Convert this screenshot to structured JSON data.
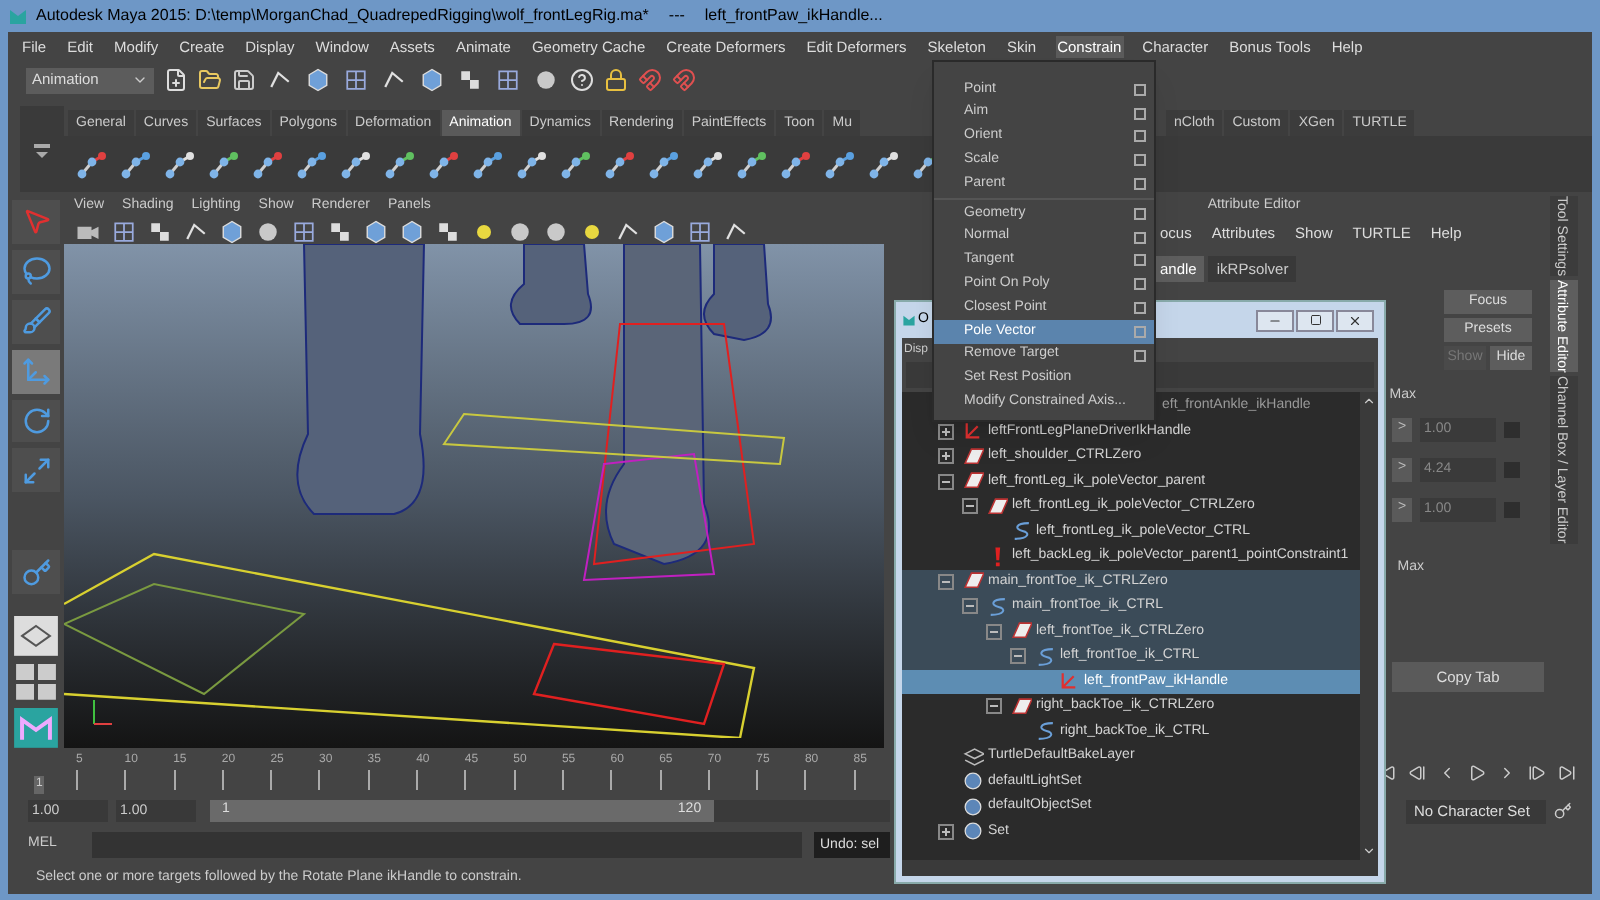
{
  "window": {
    "title": "Autodesk Maya 2015: D:\\temp\\MorganChad_QuadrepedRigging\\wolf_frontLegRig.ma*",
    "separator": "---",
    "selection": "left_frontPaw_ikHandle..."
  },
  "menu_bar": [
    {
      "label": "File",
      "selected": false
    },
    {
      "label": "Edit",
      "selected": false
    },
    {
      "label": "Modify",
      "selected": false
    },
    {
      "label": "Create",
      "selected": false
    },
    {
      "label": "Display",
      "selected": false
    },
    {
      "label": "Window",
      "selected": false
    },
    {
      "label": "Assets",
      "selected": false
    },
    {
      "label": "Animate",
      "selected": false
    },
    {
      "label": "Geometry Cache",
      "selected": false
    },
    {
      "label": "Create Deformers",
      "selected": false
    },
    {
      "label": "Edit Deformers",
      "selected": false
    },
    {
      "label": "Skeleton",
      "selected": false
    },
    {
      "label": "Skin",
      "selected": false
    },
    {
      "label": "Constrain",
      "selected": true
    },
    {
      "label": "Character",
      "selected": false
    },
    {
      "label": "Bonus Tools",
      "selected": false
    },
    {
      "label": "Help",
      "selected": false
    }
  ],
  "menu_set": "Animation",
  "shelf_tabs": [
    {
      "label": "General",
      "selected": false
    },
    {
      "label": "Curves",
      "selected": false
    },
    {
      "label": "Surfaces",
      "selected": false
    },
    {
      "label": "Polygons",
      "selected": false
    },
    {
      "label": "Deformation",
      "selected": false
    },
    {
      "label": "Animation",
      "selected": true
    },
    {
      "label": "Dynamics",
      "selected": false
    },
    {
      "label": "Rendering",
      "selected": false
    },
    {
      "label": "PaintEffects",
      "selected": false
    },
    {
      "label": "Toon",
      "selected": false
    },
    {
      "label": "Mu",
      "selected": false
    },
    {
      "label": "nCloth",
      "selected": false
    },
    {
      "label": "Custom",
      "selected": false
    },
    {
      "label": "XGen",
      "selected": false
    },
    {
      "label": "TURTLE",
      "selected": false
    }
  ],
  "toolbox": [
    {
      "kind": "select",
      "selected": false
    },
    {
      "kind": "lasso",
      "selected": false
    },
    {
      "kind": "paint",
      "selected": false
    },
    {
      "kind": "move",
      "selected": true
    },
    {
      "kind": "rotate",
      "selected": false
    },
    {
      "kind": "scale",
      "selected": false
    },
    {
      "kind": "ik",
      "selected": false
    }
  ],
  "viewport": {
    "menu": [
      "View",
      "Shading",
      "Lighting",
      "Show",
      "Renderer",
      "Panels"
    ]
  },
  "constrain_menu": {
    "sections": [
      [
        {
          "label": "Point",
          "option_box": true,
          "selected": false
        },
        {
          "label": "Aim",
          "option_box": true,
          "selected": false
        },
        {
          "label": "Orient",
          "option_box": true,
          "selected": false
        },
        {
          "label": "Scale",
          "option_box": true,
          "selected": false
        },
        {
          "label": "Parent",
          "option_box": true,
          "selected": false
        }
      ],
      [
        {
          "label": "Geometry",
          "option_box": true,
          "selected": false
        },
        {
          "label": "Normal",
          "option_box": true,
          "selected": false
        },
        {
          "label": "Tangent",
          "option_box": true,
          "selected": false
        },
        {
          "label": "Point On Poly",
          "option_box": true,
          "selected": false
        },
        {
          "label": "Closest Point",
          "option_box": true,
          "selected": false
        },
        {
          "label": "Pole Vector",
          "option_box": true,
          "selected": true
        },
        {
          "label": "Remove Target",
          "option_box": true,
          "selected": false
        },
        {
          "label": "Set Rest Position",
          "option_box": false,
          "selected": false
        },
        {
          "label": "Modify Constrained Axis...",
          "option_box": false,
          "selected": false
        }
      ]
    ]
  },
  "attribute_editor": {
    "title": "Attribute Editor",
    "menu": [
      "ocus",
      "Attributes",
      "Show",
      "TURTLE",
      "Help"
    ],
    "tabs": [
      {
        "label": "andle",
        "selected": true
      },
      {
        "label": "ikRPsolver",
        "selected": false
      }
    ],
    "buttons": [
      {
        "label": "Focus",
        "disabled": false
      },
      {
        "label": "Presets",
        "disabled": false
      },
      {
        "label": "Show",
        "disabled": true
      },
      {
        "label": "Hide",
        "disabled": false
      }
    ],
    "max_header": "Max",
    "fields": [
      {
        "button": ">",
        "value": "1.00"
      },
      {
        "button": ">",
        "value": "4.24"
      },
      {
        "button": ">",
        "value": "1.00"
      }
    ],
    "max_header_2": "Max",
    "copy_tab": "Copy Tab"
  },
  "side_tabs": [
    {
      "label": "Tool Settings",
      "selected": false
    },
    {
      "label": "Attribute Editor",
      "selected": true
    },
    {
      "label": "Channel Box / Layer Editor",
      "selected": false
    }
  ],
  "outliner": {
    "title": "O",
    "menu": [
      "Disp"
    ],
    "partial_row": "eft_frontAnkle_ikHandle",
    "nodes": [
      {
        "label": "leftFrontLegPlaneDriverIkHandle",
        "kind": "ikhandle",
        "expanded": false,
        "selected": false,
        "highlighted": false
      },
      {
        "label": "left_shoulder_CTRLZero",
        "kind": "transform",
        "expanded": false,
        "selected": false,
        "highlighted": false
      },
      {
        "label": "left_frontLeg_ik_poleVector_parent",
        "kind": "transform",
        "expanded": true,
        "selected": false,
        "highlighted": false,
        "children": [
          {
            "label": "left_frontLeg_ik_poleVector_CTRLZero",
            "kind": "transform",
            "expanded": true,
            "selected": false,
            "highlighted": false,
            "children": [
              {
                "label": "left_frontLeg_ik_poleVector_CTRL",
                "kind": "curve",
                "selected": false,
                "highlighted": false
              }
            ]
          },
          {
            "label": "left_backLeg_ik_poleVector_parent1_pointConstraint1",
            "kind": "constraint",
            "selected": false,
            "highlighted": false
          }
        ]
      },
      {
        "label": "main_frontToe_ik_CTRLZero",
        "kind": "transform",
        "expanded": true,
        "selected": false,
        "highlighted": true,
        "children": [
          {
            "label": "main_frontToe_ik_CTRL",
            "kind": "curve",
            "expanded": true,
            "selected": false,
            "highlighted": true,
            "children": [
              {
                "label": "left_frontToe_ik_CTRLZero",
                "kind": "transform",
                "expanded": true,
                "selected": false,
                "highlighted": true,
                "children": [
                  {
                    "label": "left_frontToe_ik_CTRL",
                    "kind": "curve",
                    "expanded": true,
                    "selected": false,
                    "highlighted": true,
                    "children": [
                      {
                        "label": "left_frontPaw_ikHandle",
                        "kind": "ikhandle",
                        "selected": true,
                        "highlighted": true
                      }
                    ]
                  }
                ]
              },
              {
                "label": "right_backToe_ik_CTRLZero",
                "kind": "transform",
                "expanded": true,
                "selected": false,
                "highlighted": false,
                "children": [
                  {
                    "label": "right_backToe_ik_CTRL",
                    "kind": "curve",
                    "selected": false,
                    "highlighted": false
                  }
                ]
              }
            ]
          }
        ]
      },
      {
        "label": "TurtleDefaultBakeLayer",
        "kind": "layer",
        "selected": false,
        "highlighted": false
      },
      {
        "label": "defaultLightSet",
        "kind": "set",
        "selected": false,
        "highlighted": false
      },
      {
        "label": "defaultObjectSet",
        "kind": "set",
        "selected": false,
        "highlighted": false
      },
      {
        "label": "Set",
        "kind": "set",
        "expanded": false,
        "selected": false,
        "highlighted": false
      }
    ]
  },
  "time_slider": {
    "level": 0,
    "ticks": [
      "5",
      "10",
      "15",
      "20",
      "25",
      "30",
      "35",
      "40",
      "45",
      "50",
      "55",
      "60",
      "65",
      "70",
      "75",
      "80",
      "85"
    ],
    "current_frame": "1"
  },
  "range_slider": {
    "level": 0.74,
    "start": "1.00",
    "playback_start": "1.00",
    "min": "1",
    "max": "120"
  },
  "character_set": "No Character Set",
  "command_line": {
    "label": "MEL",
    "result": "Undo: sel"
  },
  "help_line": "Select one or more targets followed by the Rotate Plane ikHandle to constrain."
}
